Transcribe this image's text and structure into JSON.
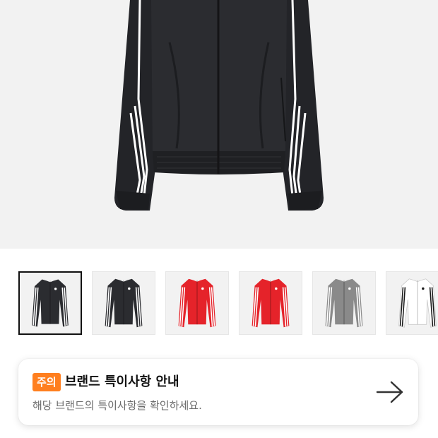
{
  "product": {
    "hero_image": "black-track-jacket-image",
    "thumbnails": [
      {
        "color": "black",
        "body": "#2b2c30",
        "stripe": "#ffffff",
        "selected": true
      },
      {
        "color": "black",
        "body": "#2b2c30",
        "stripe": "#ffffff",
        "selected": false
      },
      {
        "color": "red",
        "body": "#e5232a",
        "stripe": "#ffffff",
        "selected": false
      },
      {
        "color": "red",
        "body": "#e5232a",
        "stripe": "#ffffff",
        "selected": false
      },
      {
        "color": "grey",
        "body": "#8a8a8a",
        "stripe": "#ffffff",
        "selected": false
      },
      {
        "color": "white",
        "body": "#ffffff",
        "stripe": "#1a1a1a",
        "selected": false
      }
    ]
  },
  "notice": {
    "badge": "주의",
    "title": "브랜드 특이사항 안내",
    "description": "해당 브랜드의 특이사항을 확인하세요.",
    "arrow_icon": "arrow-right-icon"
  },
  "colors": {
    "badge": "#ff7f1f",
    "hero_bg": "#f2f2f2",
    "title": "#111111",
    "description": "#6b6b6b"
  }
}
